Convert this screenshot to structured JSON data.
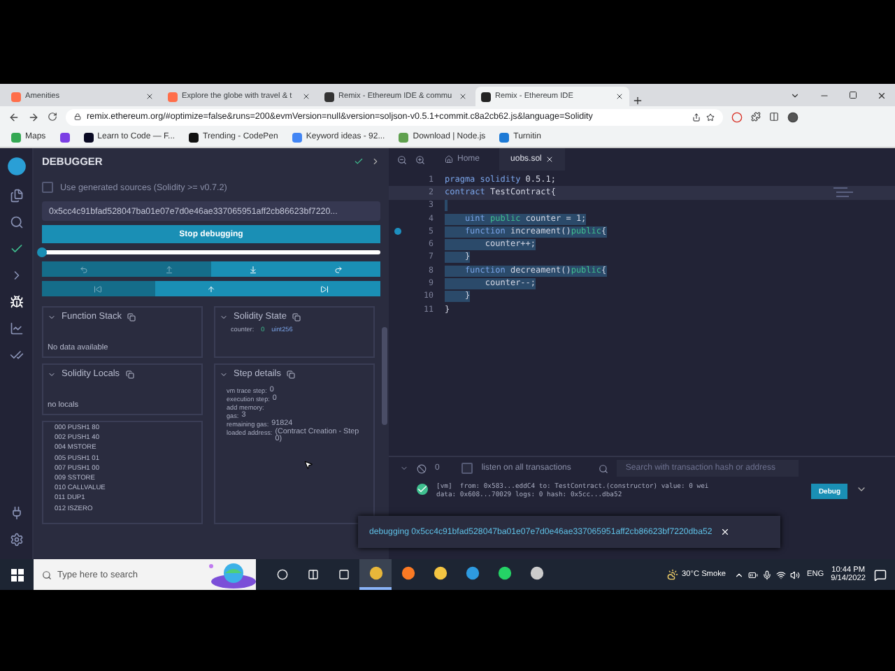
{
  "browser": {
    "tabs": [
      {
        "title": "Amenities",
        "selected": false
      },
      {
        "title": "Explore the globe with travel & t",
        "selected": false
      },
      {
        "title": "Remix - Ethereum IDE & commu",
        "selected": false
      },
      {
        "title": "Remix - Ethereum IDE",
        "selected": true
      }
    ],
    "address": "remix.ethereum.org/#optimize=false&runs=200&evmVersion=null&version=soljson-v0.5.1+commit.c8a2cb62.js&language=Solidity",
    "bookmarks": [
      {
        "kind": "link",
        "label": "Maps"
      },
      {
        "kind": "icon"
      },
      {
        "kind": "link",
        "label": "Learn to Code — F..."
      },
      {
        "kind": "link",
        "label": "Trending - CodePen"
      },
      {
        "kind": "link",
        "label": "Keyword ideas - 92..."
      },
      {
        "kind": "link",
        "label": "Download | Node.js"
      },
      {
        "kind": "link",
        "label": "Turnitin"
      }
    ]
  },
  "debugger": {
    "title": "DEBUGGER",
    "generated_sources": {
      "label": "Use generated sources (Solidity >= v0.7.2)",
      "checked": false
    },
    "tx_hash": "0x5cc4c91bfad528047ba01e07e7d0e46ae337065951aff2cb86623bf7220...",
    "stop_button": "Stop debugging",
    "slider": {
      "level": 0
    },
    "step_rows": [
      [
        {
          "kind": "step-over-back",
          "disabled": true
        },
        {
          "kind": "step-back",
          "disabled": true
        },
        {
          "kind": "step-into",
          "disabled": false
        },
        {
          "kind": "step-over-forward",
          "disabled": false
        }
      ],
      [
        {
          "kind": "jump-previous-breakpoint",
          "disabled": true
        },
        {
          "kind": "jump-out",
          "disabled": false
        },
        {
          "kind": "jump-next-breakpoint",
          "disabled": false
        }
      ]
    ],
    "function_stack": {
      "title": "Function Stack",
      "text": "No data available"
    },
    "solidity_state": {
      "title": "Solidity State",
      "name": "counter:",
      "value": "0",
      "type": "uint256"
    },
    "solidity_locals": {
      "title": "Solidity Locals",
      "text": "no locals"
    },
    "opcodes": [
      "000 PUSH1 80",
      "002 PUSH1 40",
      "004 MSTORE",
      "005 PUSH1 01",
      "007 PUSH1 00",
      "009 SSTORE",
      "010 CALLVALUE",
      "011 DUP1",
      "012 ISZERO"
    ],
    "step_details": {
      "title": "Step details",
      "rows": [
        {
          "label": "vm trace step:",
          "value": "0"
        },
        {
          "label": "execution step:",
          "value": "0"
        },
        {
          "label": "add memory:"
        },
        {
          "label": "gas:",
          "value": "3"
        },
        {
          "label": "remaining gas:",
          "value": "91824"
        },
        {
          "label": "loaded address:",
          "value": "(Contract Creation - Step 0)"
        }
      ]
    }
  },
  "editor": {
    "tabs": [
      {
        "label": "Home",
        "selected": false
      },
      {
        "label": "uobs.sol",
        "selected": true
      }
    ],
    "lines": [
      {
        "number": "1",
        "tokens": [
          {
            "text": "pragma solidity",
            "kind": "keyword"
          },
          {
            "text": " 0.5.1;",
            "kind": "plain"
          }
        ],
        "active": false,
        "highlighted": false,
        "breakpoint": false
      },
      {
        "number": "2",
        "tokens": [
          {
            "text": "contract",
            "kind": "keyword"
          },
          {
            "text": " TestContract{",
            "kind": "plain"
          }
        ],
        "active": true,
        "highlighted": false,
        "breakpoint": false
      },
      {
        "number": "3",
        "active": false,
        "highlighted": true,
        "breakpoint": false
      },
      {
        "number": "4",
        "tokens": [
          {
            "text": "    uint ",
            "kind": "keyword"
          },
          {
            "text": "public",
            "kind": "modifier"
          },
          {
            "text": " counter = 1;",
            "kind": "plain"
          }
        ],
        "active": false,
        "highlighted": true,
        "breakpoint": false
      },
      {
        "number": "5",
        "tokens": [
          {
            "text": "    function ",
            "kind": "keyword"
          },
          {
            "text": "increament()",
            "kind": "plain"
          },
          {
            "text": "public",
            "kind": "modifier"
          },
          {
            "text": "{",
            "kind": "plain"
          }
        ],
        "active": false,
        "highlighted": true,
        "breakpoint": true
      },
      {
        "number": "6",
        "tokens": [
          {
            "text": "        counter++;",
            "kind": "plain"
          }
        ],
        "active": false,
        "highlighted": true,
        "breakpoint": false
      },
      {
        "number": "7",
        "tokens": [
          {
            "text": "    }",
            "kind": "plain"
          }
        ],
        "active": false,
        "highlighted": true,
        "breakpoint": false
      },
      {
        "number": "8",
        "tokens": [
          {
            "text": "    function ",
            "kind": "keyword"
          },
          {
            "text": "decreament()",
            "kind": "plain"
          },
          {
            "text": "public",
            "kind": "modifier"
          },
          {
            "text": "{",
            "kind": "plain"
          }
        ],
        "active": false,
        "highlighted": true,
        "breakpoint": false
      },
      {
        "number": "9",
        "tokens": [
          {
            "text": "        counter--;",
            "kind": "plain"
          }
        ],
        "active": false,
        "highlighted": true,
        "breakpoint": false
      },
      {
        "number": "10",
        "tokens": [
          {
            "text": "    }",
            "kind": "plain"
          }
        ],
        "active": false,
        "highlighted": true,
        "breakpoint": false
      },
      {
        "number": "11",
        "tokens": [
          {
            "text": "}",
            "kind": "plain"
          }
        ],
        "active": false,
        "highlighted": false,
        "breakpoint": false
      }
    ]
  },
  "terminal": {
    "count": "0",
    "listen": {
      "label": "listen on all transactions",
      "checked": false
    },
    "search_placeholder": "Search with transaction hash or address",
    "log": [
      "[vm]  from: 0x583...eddC4 to: TestContract.(constructor) value: 0 wei",
      "data: 0x608...70029 logs: 0 hash: 0x5cc...dba52"
    ],
    "debug_button": "Debug",
    "toast": "debugging 0x5cc4c91bfad528047ba01e07e7d0e46ae337065951aff2cb86623bf7220dba52"
  },
  "taskbar": {
    "search_placeholder": "Type here to search",
    "weather": "30°C  Smoke",
    "language": "ENG",
    "time": "10:44 PM",
    "date": "9/14/2022",
    "apps": [
      {
        "kind": "chrome",
        "selected": true
      },
      {
        "kind": "xampp",
        "selected": false
      },
      {
        "kind": "explorer",
        "selected": false
      },
      {
        "kind": "edge",
        "selected": false
      },
      {
        "kind": "whatsapp",
        "selected": false
      },
      {
        "kind": "recorder",
        "selected": false
      }
    ]
  }
}
